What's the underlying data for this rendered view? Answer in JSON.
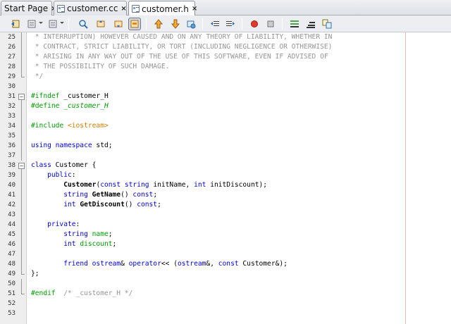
{
  "tabs": [
    {
      "label": "Start Page",
      "icon": "none",
      "active": false
    },
    {
      "label": "customer.cc",
      "icon": "cpp-file-icon",
      "active": false
    },
    {
      "label": "customer.h",
      "icon": "header-file-icon",
      "active": true
    }
  ],
  "tab_close_glyph": "×",
  "toolbar": {
    "buttons": [
      "back-icon",
      "history-icon",
      "forward-icon",
      "find-selection-icon",
      "find-previous-icon",
      "find-next-icon",
      "toggle-highlight-icon",
      "previous-bookmark-icon",
      "next-bookmark-icon",
      "toggle-bookmark-icon",
      "shift-left-icon",
      "shift-right-icon",
      "start-macro-icon",
      "stop-macro-icon",
      "comment-icon",
      "uncomment-icon",
      "diff-icon"
    ]
  },
  "editor": {
    "lines": [
      {
        "n": "25",
        "fold": "v",
        "tokens": [
          [
            "comment",
            " * INTERRUPTION) HOWEVER CAUSED AND ON ANY THEORY OF LIABILITY, WHETHER IN"
          ]
        ]
      },
      {
        "n": "26",
        "fold": "v",
        "tokens": [
          [
            "comment",
            " * CONTRACT, STRICT LIABILITY, OR TORT (INCLUDING NEGLIGENCE OR OTHERWISE)"
          ]
        ]
      },
      {
        "n": "27",
        "fold": "v",
        "tokens": [
          [
            "comment",
            " * ARISING IN ANY WAY OUT OF THE USE OF THIS SOFTWARE, EVEN IF ADVISED OF"
          ]
        ]
      },
      {
        "n": "28",
        "fold": "v",
        "tokens": [
          [
            "comment",
            " * THE POSSIBILITY OF SUCH DAMAGE."
          ]
        ]
      },
      {
        "n": "29",
        "fold": "end",
        "tokens": [
          [
            "comment",
            " */"
          ]
        ]
      },
      {
        "n": "30",
        "fold": "",
        "tokens": []
      },
      {
        "n": "31",
        "fold": "open",
        "tokens": [
          [
            "pre",
            "#ifndef "
          ],
          [
            "plain",
            "_customer_H"
          ]
        ]
      },
      {
        "n": "32",
        "fold": "v",
        "tokens": [
          [
            "pre",
            "#define "
          ],
          [
            "macro",
            "_customer_H"
          ]
        ]
      },
      {
        "n": "33",
        "fold": "v",
        "tokens": []
      },
      {
        "n": "34",
        "fold": "v",
        "tokens": [
          [
            "pre",
            "#include "
          ],
          [
            "string",
            "<iostream>"
          ]
        ]
      },
      {
        "n": "35",
        "fold": "v",
        "tokens": []
      },
      {
        "n": "36",
        "fold": "v",
        "tokens": [
          [
            "keyword",
            "using namespace "
          ],
          [
            "plain",
            "std;"
          ]
        ]
      },
      {
        "n": "37",
        "fold": "v",
        "tokens": []
      },
      {
        "n": "38",
        "fold": "open",
        "tokens": [
          [
            "keyword",
            "class "
          ],
          [
            "plain",
            "Customer {"
          ]
        ]
      },
      {
        "n": "39",
        "fold": "v",
        "tokens": [
          [
            "keyword",
            "    public"
          ],
          [
            "plain",
            ":"
          ]
        ]
      },
      {
        "n": "40",
        "fold": "v",
        "tokens": [
          [
            "plain",
            "        "
          ],
          [
            "func",
            "Customer"
          ],
          [
            "plain",
            "("
          ],
          [
            "keyword",
            "const "
          ],
          [
            "type",
            "string "
          ],
          [
            "plain",
            "initName, "
          ],
          [
            "type",
            "int "
          ],
          [
            "plain",
            "initDiscount);"
          ]
        ]
      },
      {
        "n": "41",
        "fold": "v",
        "tokens": [
          [
            "plain",
            "        "
          ],
          [
            "type",
            "string "
          ],
          [
            "func",
            "GetName"
          ],
          [
            "plain",
            "() "
          ],
          [
            "keyword",
            "const"
          ],
          [
            "plain",
            ";"
          ]
        ]
      },
      {
        "n": "42",
        "fold": "v",
        "tokens": [
          [
            "plain",
            "        "
          ],
          [
            "type",
            "int "
          ],
          [
            "func",
            "GetDiscount"
          ],
          [
            "plain",
            "() "
          ],
          [
            "keyword",
            "const"
          ],
          [
            "plain",
            ";"
          ]
        ]
      },
      {
        "n": "43",
        "fold": "v",
        "tokens": []
      },
      {
        "n": "44",
        "fold": "v",
        "tokens": [
          [
            "keyword",
            "    private"
          ],
          [
            "plain",
            ":"
          ]
        ]
      },
      {
        "n": "45",
        "fold": "v",
        "tokens": [
          [
            "plain",
            "        "
          ],
          [
            "type",
            "string "
          ],
          [
            "field",
            "name"
          ],
          [
            "plain",
            ";"
          ]
        ]
      },
      {
        "n": "46",
        "fold": "v",
        "tokens": [
          [
            "plain",
            "        "
          ],
          [
            "type",
            "int "
          ],
          [
            "field",
            "discount"
          ],
          [
            "plain",
            ";"
          ]
        ]
      },
      {
        "n": "47",
        "fold": "v",
        "tokens": []
      },
      {
        "n": "48",
        "fold": "v",
        "tokens": [
          [
            "plain",
            "        "
          ],
          [
            "keyword",
            "friend "
          ],
          [
            "type",
            "ostream"
          ],
          [
            "plain",
            "& "
          ],
          [
            "keyword",
            "operator"
          ],
          [
            "plain",
            "<< ("
          ],
          [
            "type",
            "ostream"
          ],
          [
            "plain",
            "&, "
          ],
          [
            "keyword",
            "const "
          ],
          [
            "plain",
            "Customer&);"
          ]
        ]
      },
      {
        "n": "49",
        "fold": "end",
        "tokens": [
          [
            "plain",
            "};"
          ]
        ]
      },
      {
        "n": "50",
        "fold": "v",
        "tokens": []
      },
      {
        "n": "51",
        "fold": "end",
        "tokens": [
          [
            "pre",
            "#endif  "
          ],
          [
            "comment",
            "/* _customer_H */"
          ]
        ]
      },
      {
        "n": "52",
        "fold": "",
        "tokens": []
      },
      {
        "n": "53",
        "fold": "",
        "tokens": []
      }
    ]
  }
}
